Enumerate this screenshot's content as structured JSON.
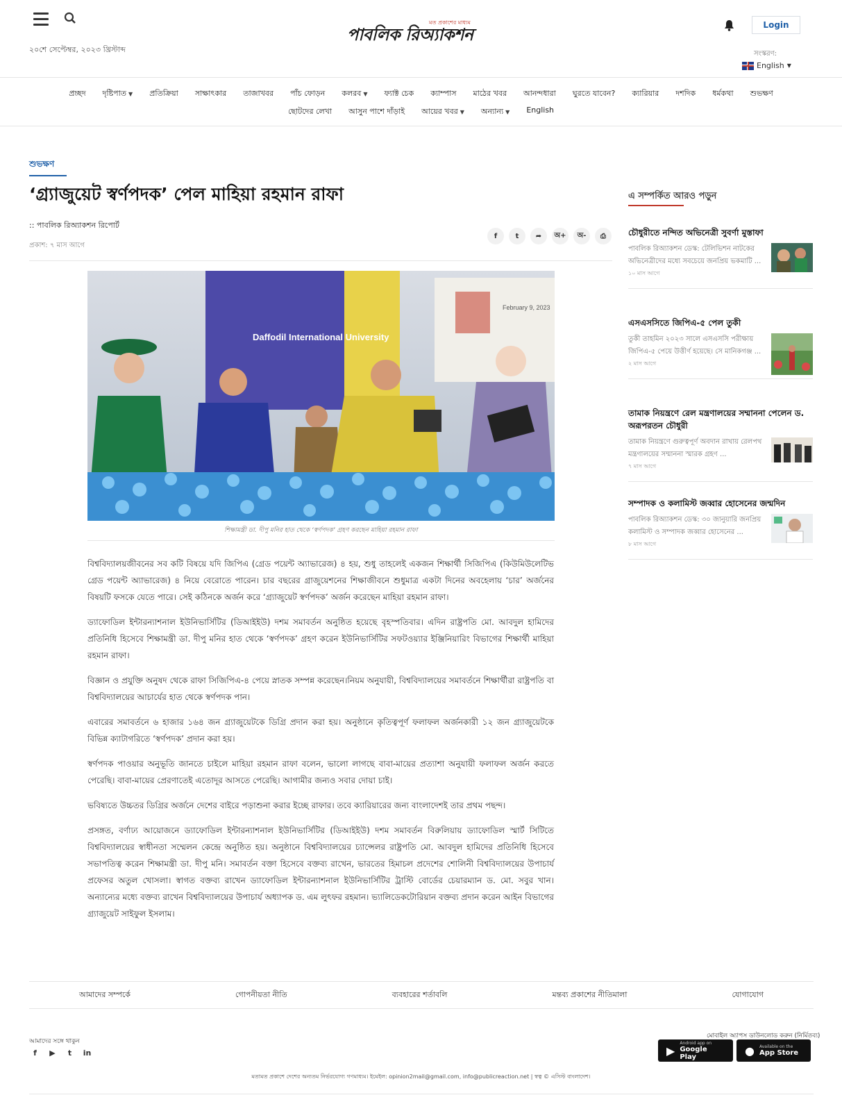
{
  "header": {
    "date": "২০শে সেপ্টেম্বর, ২০২৩ খ্রিস্টাব্দ",
    "logo_text": "পাবলিক রিঅ্যাকশন",
    "logo_tagline": "মত প্রকাশের মাধ্যম",
    "login_label": "Login",
    "edition_label": "সংস্করণ:",
    "language": "English",
    "icons": [
      "menu-icon",
      "search-icon",
      "bell-icon",
      "uk-flag-icon",
      "chevron-down-icon"
    ]
  },
  "nav": {
    "row1": [
      {
        "label": "প্রচ্ছদ",
        "dropdown": false
      },
      {
        "label": "দৃষ্টিপাত",
        "dropdown": true
      },
      {
        "label": "প্রতিক্রিয়া",
        "dropdown": false
      },
      {
        "label": "সাক্ষাৎকার",
        "dropdown": false
      },
      {
        "label": "তাজাখবর",
        "dropdown": false
      },
      {
        "label": "পাঁচ ফোড়ন",
        "dropdown": false
      },
      {
        "label": "কলরব",
        "dropdown": true
      },
      {
        "label": "ফ্যাক্ট চেক",
        "dropdown": false
      },
      {
        "label": "ক্যাম্পাস",
        "dropdown": false
      },
      {
        "label": "মাঠের খবর",
        "dropdown": false
      },
      {
        "label": "আনন্দধারা",
        "dropdown": false
      },
      {
        "label": "ঘুরতে যাবেন?",
        "dropdown": false
      },
      {
        "label": "ক্যারিয়ার",
        "dropdown": false
      },
      {
        "label": "দশদিক",
        "dropdown": false
      },
      {
        "label": "ধর্মকথা",
        "dropdown": false
      },
      {
        "label": "শুভক্ষণ",
        "dropdown": false
      }
    ],
    "row2": [
      {
        "label": "ছোটদের লেখা",
        "dropdown": false
      },
      {
        "label": "আসুন পাশে দাঁড়াই",
        "dropdown": false
      },
      {
        "label": "আয়ের খবর",
        "dropdown": true
      },
      {
        "label": "অন্যান্য",
        "dropdown": true
      },
      {
        "label": "English",
        "dropdown": false
      }
    ]
  },
  "article": {
    "category": "শুভক্ষণ",
    "title": "‘গ্র্যাজুয়েট স্বর্ণপদক’ পেল মাহিয়া রহমান রাফা",
    "byline": ":: পাবলিক রিঅ্যাকশন রিপোর্ট",
    "published": "প্রকাশ: ৭ মাস আগে",
    "share_buttons": [
      {
        "icon": "facebook-icon",
        "glyph": "f"
      },
      {
        "icon": "twitter-icon",
        "glyph": "t"
      },
      {
        "icon": "share-icon",
        "glyph": "➦"
      },
      {
        "icon": "font-increase-icon",
        "glyph": "অ+"
      },
      {
        "icon": "font-decrease-icon",
        "glyph": "অ-"
      },
      {
        "icon": "print-icon",
        "glyph": "⎙"
      }
    ],
    "photo_caption": "শিক্ষামন্ত্রী ডা. দীপু মনির হাত থেকে ‘স্বর্ণপদক’ গ্রহণ করছেন মাহিয়া রহমান রাফা",
    "photo_banner_date": "February 9, 2023",
    "photo_banner_text": "Daffodil International University",
    "paragraphs": [
      "বিশ্ববিদ্যালয়জীবনের সব কটি বিষয়ে যদি জিপিএ (গ্রেড পয়েন্ট অ্যাভারেজ) ৪ হয়, শুধু তাহলেই একজন শিক্ষার্থী সিজিপিএ (কিউমিউলেটিভ গ্রেড পয়েন্ট অ্যাভারেজ) ৪ নিয়ে বেরোতে পারেন। চার বছরের গ্রাজুয়েশনের শিক্ষাজীবনে শুধুমাত্র একটা দিনের অবহেলায় ‘চার’ অর্জনের বিষয়টি ফসকে যেতে পারে। সেই কঠিনকে অর্জন করে ‘গ্র্যাজুয়েট স্বর্ণপদক’ অর্জন করেছেন মাহিয়া রহমান রাফা।",
      "ড্যাফোডিল ইন্টারন্যাশনাল ইউনিভার্সিটির (ডিআইইউ) দশম সমাবর্তন অনুষ্ঠিত হয়েছে বৃহস্পতিবার। এদিন রাষ্ট্রপতি মো. আবদুল হামিদের প্রতিনিধি হিসেবে শিক্ষামন্ত্রী ডা. দীপু মনির হাত থেকে ‘স্বর্ণপদক’ গ্রহণ করেন ইউনিভার্সিটির সফটওয়্যার ইঞ্জিনিয়ারিং বিভাগের শিক্ষার্থী মাহিয়া রহমান রাফা।",
      "বিজ্ঞান ও প্রযুক্তি অনুষদ থেকে রাফা সিজিপিএ-৪ পেয়ে স্নাতক সম্পন্ন করেছেন।নিয়ম অনুযায়ী, বিশ্ববিদ্যালয়ের সমাবর্তনে শিক্ষার্থীরা রাষ্ট্রপতি বা বিশ্ববিদ্যালয়ের আচার্যের হাত থেকে স্বর্ণপদক পান।",
      "এবারের সমাবর্তনে ৬ হাজার ১৬৪ জন গ্র্যাজুয়েটকে ডিগ্রি প্রদান করা হয়। অনুষ্ঠানে কৃতিত্বপূর্ণ ফলাফল অর্জনকারী ১২ জন গ্র্যাজুয়েটকে বিভিন্ন ক্যাটাগরিতে ‘স্বর্ণপদক’ প্রদান করা হয়।",
      "স্বর্ণপদক পাওয়ার অনুভূতি জানতে চাইলে মাহিয়া রহমান রাফা বলেন, ভালো লাগছে বাবা-মায়ের প্রত্যাশা অনুযায়ী ফলাফল অর্জন করতে পেরেছি। বাবা-মায়ের প্রেরণাতেই এতোদূর আসতে পেরেছি। আগামীর জন্যও সবার দোয়া চাই।",
      "ভবিষ্যতে উচ্চতর ডিগ্রির অর্জনে দেশের বাইরে পড়াশুনা করার ইচ্ছে রাফার। তবে ক্যারিয়ারের জন্য বাংলাদেশই তার প্রথম পছন্দ।",
      "প্রসঙ্গত, বর্ণাঢ্য আয়োজনে ড্যাফোডিল ইন্টারন্যাশনাল ইউনিভার্সিটির (ডিআইইউ) দশম সমাবর্তন বিরুলিয়ায় ড্যাফোডিল স্মার্ট সিটিতে বিশ্ববিদ্যালয়ের স্বাধীনতা সম্মেলন কেন্দ্রে অনুষ্ঠিত হয়। অনুষ্ঠানে বিশ্ববিদ্যালয়ের চ্যান্সেলর রাষ্ট্রপতি মো. আবদুল হামিদের প্রতিনিধি হিসেবে সভাপতিত্ব করেন শিক্ষামন্ত্রী ডা. দীপু মনি। সমাবর্তন বক্তা হিসেবে বক্তব্য রাখেন, ভারতের হিমাচল প্রদেশের শোলিনী বিশ্ববিদ্যালয়ের উপাচার্য প্রফেসর অতুল খোসলা। স্বাগত বক্তব্য রাখেন ড্যাফোডিল ইন্টারন্যাশনাল ইউনিভার্সিটির ট্রাস্টি বোর্ডের চেয়ারম্যান ড. মো. সবুর খান। অন্যান্যের মধ্যে বক্তব্য রাখেন বিশ্ববিদ্যালয়ের উপাচার্য অধ্যাপক ড. এম লুৎফর রহমান। ভ্যালিডেকটোরিয়ান বক্তব্য প্রদান করেন আইন বিভাগের গ্র্যাজুয়েট সাইফুল ইসলাম।"
    ]
  },
  "sidebar": {
    "heading": "এ সম্পর্কিত আরও পড়ুন",
    "items": [
      {
        "title": "চৌধুরীতে নন্দিত অভিনেত্রী সুবর্ণা মুস্তাফা",
        "excerpt": "পাবলিক রিঅ্যাকশন ডেস্ক: টেলিভিশন নাটকের অভিনেত্রীদের মধ্যে সবচেয়ে জনপ্রিয় ভকমাটি ...",
        "time": "১০ মাস আগে"
      },
      {
        "title": "এসএসসিতে জিপিএ-৫ পেল তুকী",
        "excerpt": "তুকী তাহমিন ২০২৩ সালে এসএসসি পরীক্ষায় জিপিএ-৫ পেয়ে উত্তীর্ণ হয়েছে। সে মানিকগঞ্জ ...",
        "time": "২ মাস আগে"
      },
      {
        "title": "তামাক নিয়ন্ত্রণে রেল মন্ত্রণালয়ের সম্মাননা পেলেন ড. অরূপরতন চৌধুরী",
        "excerpt": "তামাক নিয়ন্ত্রণে গুরুত্বপূর্ণ অবদান রাখায় রেলপথ মন্ত্রণালয়ের সম্মাননা স্মারক গ্রহণ ...",
        "time": "৭ মাস আগে"
      },
      {
        "title": "সম্পাদক ও কলামিস্ট জব্বার হোসেনের জন্মদিন",
        "excerpt": "পাবলিক রিঅ্যাকশন ডেস্ক: ৩০ জানুয়ারি জনপ্রিয় কলামিস্ট ও সম্পাদক জব্বার হোসেনের ...",
        "time": "৮ মাস আগে"
      }
    ]
  },
  "footer": {
    "links": [
      "আমাদের সম্পর্কে",
      "গোপনীয়তা নীতি",
      "ব্যবহারের শর্তাবলি",
      "মন্তব্য প্রকাশের নীতিমালা",
      "যোগাযোগ"
    ],
    "follow_label": "আমাদের সঙ্গে থাকুন",
    "social_icons": [
      {
        "icon": "facebook-icon",
        "glyph": "f"
      },
      {
        "icon": "youtube-icon",
        "glyph": "▶"
      },
      {
        "icon": "twitter-icon",
        "glyph": "t"
      },
      {
        "icon": "linkedin-icon",
        "glyph": "in"
      }
    ],
    "app_label": "মোবাইল অ্যাপস ডাউনলোড করুন (নির্মিতব্য)",
    "google_play": {
      "small": "Android app on",
      "big": "Google Play"
    },
    "app_store": {
      "small": "Available on the",
      "big": "App Store"
    },
    "copyright": "মতামত প্রকাশে দেশের অন্যতম নির্ভরযোগ্য গণমাধ্যম। ইমেইল: opinion2mail@gmail.com, info@publicreaction.net | স্বত্ব © এসিস্ট বাংলাদেশ।"
  },
  "colors": {
    "accent_blue": "#1e5fa8",
    "accent_red": "#c0392b"
  }
}
